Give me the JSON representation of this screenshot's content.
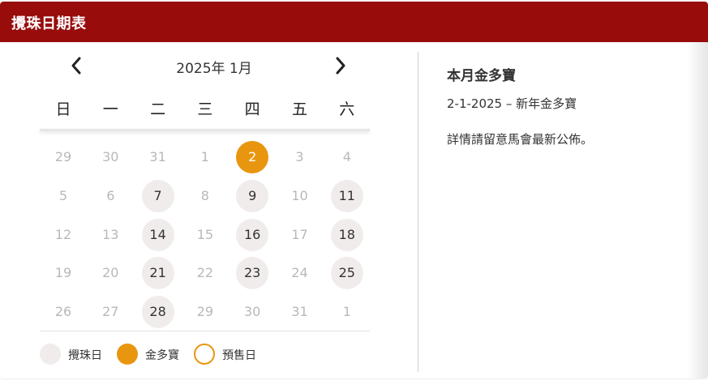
{
  "header": {
    "title": "攪珠日期表"
  },
  "colors": {
    "header_bg": "#980c0c",
    "draw_day_bg": "#f1ecec",
    "jackpot_orange": "#e8960f",
    "muted_text": "#b8b8b8"
  },
  "calendar": {
    "month_label": "2025年 1月",
    "prev_icon": "chevron-left-icon",
    "next_icon": "chevron-right-icon",
    "weekdays": [
      "日",
      "一",
      "二",
      "三",
      "四",
      "五",
      "六"
    ],
    "weeks": [
      [
        {
          "label": "29",
          "type": "other"
        },
        {
          "label": "30",
          "type": "other"
        },
        {
          "label": "31",
          "type": "other"
        },
        {
          "label": "1",
          "type": "normal"
        },
        {
          "label": "2",
          "type": "jackpot"
        },
        {
          "label": "3",
          "type": "normal"
        },
        {
          "label": "4",
          "type": "normal"
        }
      ],
      [
        {
          "label": "5",
          "type": "normal"
        },
        {
          "label": "6",
          "type": "normal"
        },
        {
          "label": "7",
          "type": "draw"
        },
        {
          "label": "8",
          "type": "normal"
        },
        {
          "label": "9",
          "type": "draw"
        },
        {
          "label": "10",
          "type": "normal"
        },
        {
          "label": "11",
          "type": "draw"
        }
      ],
      [
        {
          "label": "12",
          "type": "normal"
        },
        {
          "label": "13",
          "type": "normal"
        },
        {
          "label": "14",
          "type": "draw"
        },
        {
          "label": "15",
          "type": "normal"
        },
        {
          "label": "16",
          "type": "draw"
        },
        {
          "label": "17",
          "type": "normal"
        },
        {
          "label": "18",
          "type": "draw"
        }
      ],
      [
        {
          "label": "19",
          "type": "normal"
        },
        {
          "label": "20",
          "type": "normal"
        },
        {
          "label": "21",
          "type": "draw"
        },
        {
          "label": "22",
          "type": "normal"
        },
        {
          "label": "23",
          "type": "draw"
        },
        {
          "label": "24",
          "type": "normal"
        },
        {
          "label": "25",
          "type": "draw"
        }
      ],
      [
        {
          "label": "26",
          "type": "normal"
        },
        {
          "label": "27",
          "type": "normal"
        },
        {
          "label": "28",
          "type": "draw"
        },
        {
          "label": "29",
          "type": "normal"
        },
        {
          "label": "30",
          "type": "normal"
        },
        {
          "label": "31",
          "type": "normal"
        },
        {
          "label": "1",
          "type": "other"
        }
      ]
    ]
  },
  "legend": {
    "draw_day": "攪珠日",
    "jackpot": "金多寶",
    "presale": "預售日"
  },
  "info": {
    "title": "本月金多寶",
    "jackpot_line": "2-1-2025 – 新年金多寶",
    "note": "詳情請留意馬會最新公佈。"
  }
}
